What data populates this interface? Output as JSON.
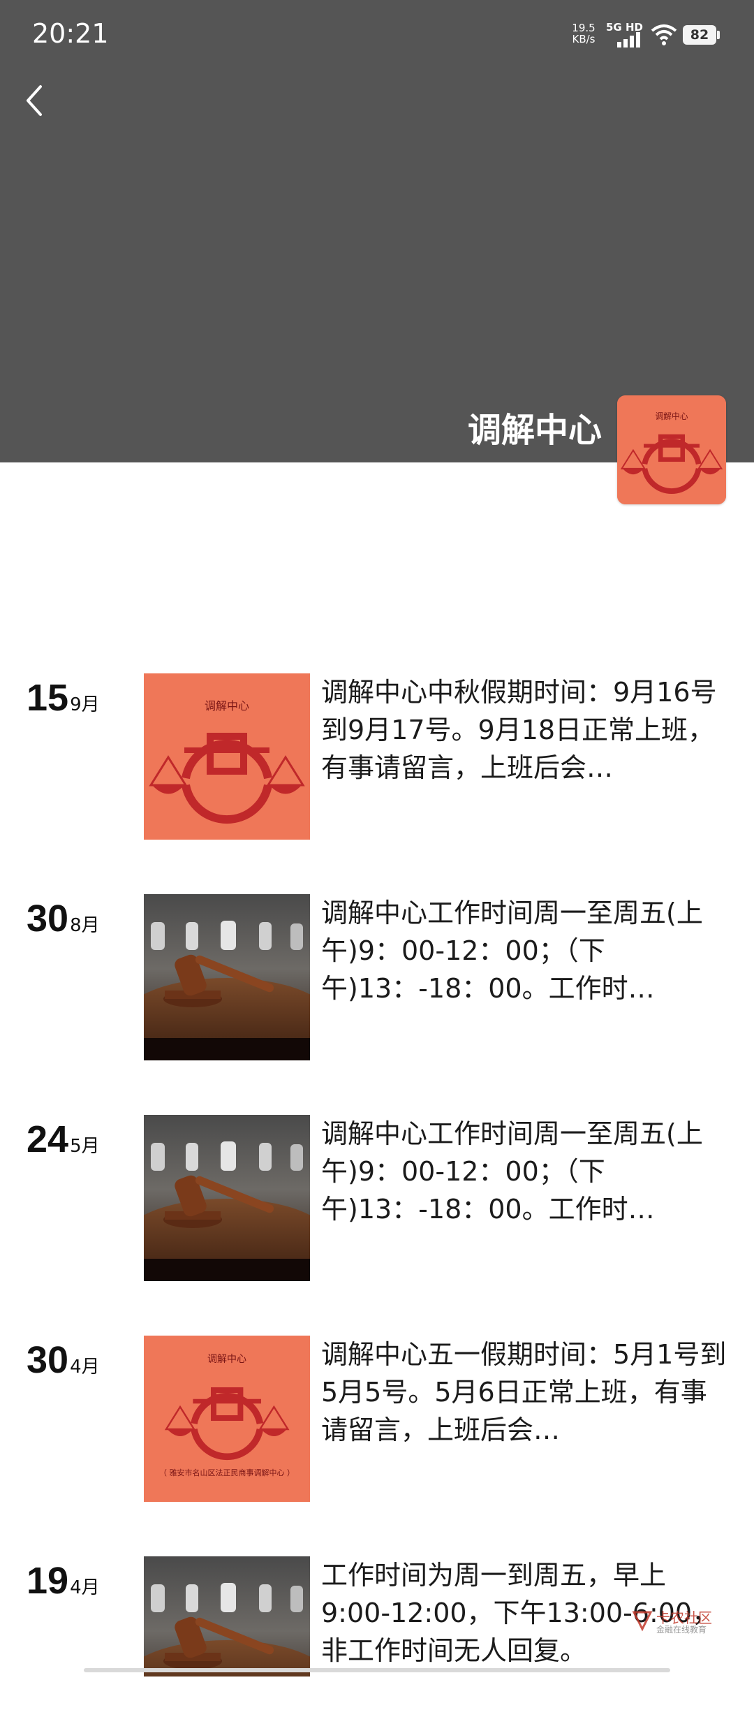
{
  "status_bar": {
    "time": "20:21",
    "net_speed_value": "19.5",
    "net_speed_unit": "KB/s",
    "network": "5G HD",
    "battery": "82"
  },
  "header": {
    "account_name": "调解中心",
    "back_icon": "chevron-left-icon"
  },
  "thumb_logo": {
    "title": "调解中心",
    "footer": "（ 雅安市名山区法正民商事调解中心 ）"
  },
  "posts": [
    {
      "day": "15",
      "month": "9月",
      "thumb": "mediation-logo",
      "text": "调解中心中秋假期时间：9月16号到9月17号。9月18日正常上班，有事请留言，上班后会…"
    },
    {
      "day": "30",
      "month": "8月",
      "thumb": "gavel",
      "text": "调解中心工作时间周一至周五(上午)9：00-12：00；（下午)13：-18：00。工作时…"
    },
    {
      "day": "24",
      "month": "5月",
      "thumb": "gavel",
      "text": "调解中心工作时间周一至周五(上午)9：00-12：00；（下午)13：-18：00。工作时…"
    },
    {
      "day": "30",
      "month": "4月",
      "thumb": "mediation-logo-with-footer",
      "text": "调解中心五一假期时间：5月1号到5月5号。5月6日正常上班，有事请留言，上班后会…"
    },
    {
      "day": "19",
      "month": "4月",
      "thumb": "gavel",
      "text": "工作时间为周一到周五，早上9:00-12:00，下午13:00-6:00，非工作时间无人回复。"
    }
  ],
  "watermark": {
    "text": "卡农社区",
    "sub": "金融在线教育"
  },
  "colors": {
    "cover": "#555555",
    "logo_bg": "#ef7758",
    "logo_red": "#c0282a"
  }
}
